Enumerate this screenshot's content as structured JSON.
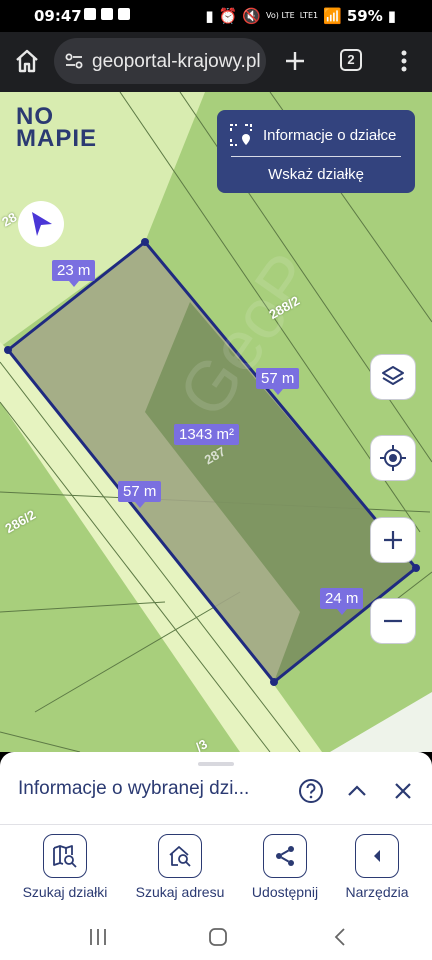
{
  "status_bar": {
    "time": "09:47",
    "battery": "59%",
    "network_top": "Vo) LTE",
    "network_bottom": "LTE1"
  },
  "browser": {
    "url": "geoportal-krajowy.pl",
    "tab_count": "2"
  },
  "map": {
    "logo_top": "NO",
    "logo_bottom": "MAPIE",
    "info_panel": {
      "parcel_info_label": "Informacje o działce",
      "select_parcel_label": "Wskaż działkę"
    },
    "measurements": {
      "top_edge": "23 m",
      "right_edge": "57 m",
      "left_edge": "57 m",
      "bottom_edge": "24 m",
      "area": "1343 m²"
    },
    "parcel_numbers": {
      "n1": "288/2",
      "n2": "286/2",
      "n3": "28",
      "n4": "/3",
      "n5": "287"
    },
    "watermark": "GeoP",
    "colors": {
      "accent": "#33437e",
      "label": "#7a6fe0",
      "parcel_border": "#1f2a80",
      "field": "#a8cf7c"
    }
  },
  "sheet": {
    "title": "Informacje o wybranej dzi...",
    "actions": [
      {
        "label": "Szukaj działki",
        "icon": "map-search-icon"
      },
      {
        "label": "Szukaj adresu",
        "icon": "home-search-icon"
      },
      {
        "label": "Udostępnij",
        "icon": "share-icon"
      },
      {
        "label": "Narzędzia",
        "icon": "chevron-left-icon"
      }
    ]
  }
}
